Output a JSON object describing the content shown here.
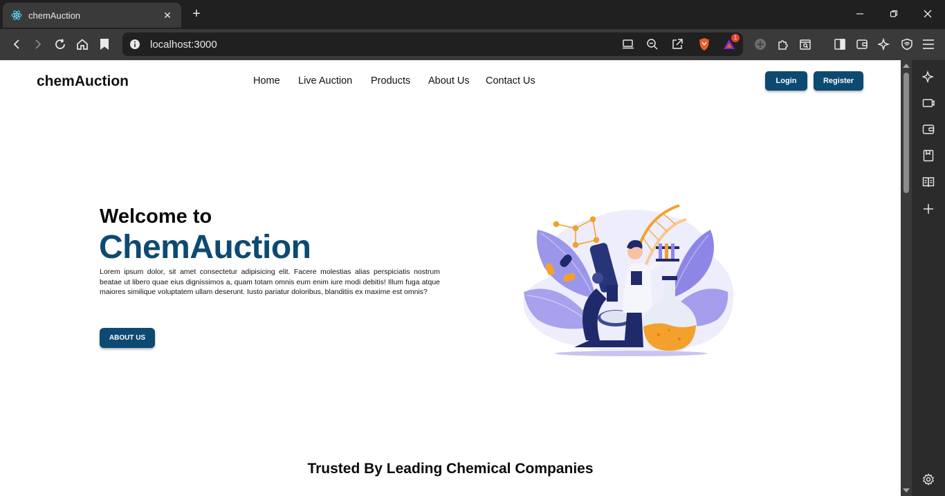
{
  "browser": {
    "tab": {
      "title": "chemAuction",
      "favicon": "react-atom-icon"
    },
    "url": "localhost:3000",
    "shields_badge": "1"
  },
  "site": {
    "brand": "chemAuction",
    "nav": [
      "Home",
      "Live Auction",
      "Products",
      "About Us",
      "Contact Us"
    ],
    "login": "Login",
    "register": "Register",
    "hero": {
      "welcome": "Welcome to",
      "title": "ChemAuction",
      "description": "Lorem ipsum dolor, sit amet consectetur adipisicing elit. Facere molestias alias perspiciatis nostrum beatae ut libero quae eius dignissimos a, quam totam omnis eum enim iure modi debitis! Illum fuga atque maiores similique voluptatem ullam deserunt. Iusto pariatur doloribus, blanditiis ex maxime est omnis?",
      "button": "ABOUT US"
    },
    "trusted_heading": "Trusted By Leading Chemical Companies"
  },
  "colors": {
    "brand": "#0c4a72",
    "illustration_purple": "#8e86e6",
    "illustration_orange": "#f3a02c"
  }
}
